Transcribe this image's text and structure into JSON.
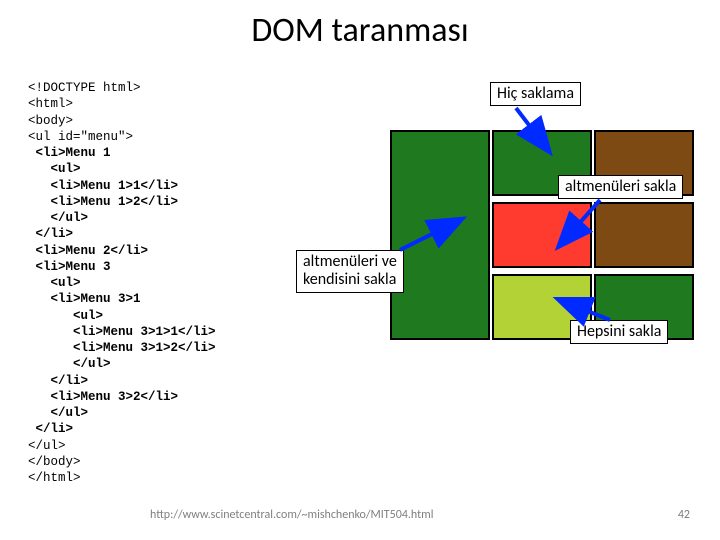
{
  "title": "DOM taranması",
  "code": {
    "l01": "<!DOCTYPE html>",
    "l02": "<html>",
    "l03": "<body>",
    "l04": "<ul id=\"menu\">",
    "l05": " <li>Menu 1",
    "l06": "   <ul>",
    "l07": "   <li>Menu 1>1</li>",
    "l08": "   <li>Menu 1>2</li>",
    "l09": "   </ul>",
    "l10": " </li>",
    "l11": " <li>Menu 2</li>",
    "l12": " <li>Menu 3",
    "l13": "   <ul>",
    "l14": "   <li>Menu 3>1",
    "l15": "      <ul>",
    "l16": "      <li>Menu 3>1>1</li>",
    "l17": "      <li>Menu 3>1>2</li>",
    "l18": "      </ul>",
    "l19": "   </li>",
    "l20": "   <li>Menu 3>2</li>",
    "l21": "   </ul>",
    "l22": " </li>",
    "l23": "</ul>",
    "l24": "</body>",
    "l25": "</html>"
  },
  "labels": {
    "hide_none": "Hiç saklama",
    "hide_submenus": "altmenüleri sakla",
    "hide_sub_and_self": "altmenüleri ve\nkendisini sakla",
    "hide_all": "Hepsini sakla"
  },
  "footer": "http://www.scinetcentral.com/~mishchenko/MIT504.html",
  "slide_number": "42"
}
